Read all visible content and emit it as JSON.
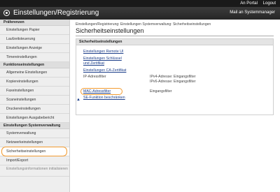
{
  "topbar": {
    "portal": "An Portal",
    "logout": "Logout"
  },
  "header": {
    "title": "Einstellungen/Registrierung",
    "mail_link": "Mail an Systemmanager"
  },
  "sidebar": {
    "sections": [
      {
        "heading": "Präferenzen",
        "items": [
          "Einstellungen Papier",
          "Laufzeitsteuerung",
          "Einstellungen Anzeige",
          "Timereinstellungen"
        ]
      },
      {
        "heading": "Funktionseinstellungen",
        "items": [
          "Allgemeine Einstellungen",
          "Kopiereinstellungen",
          "Faxeinstellungen",
          "Scaneinstellungen",
          "Druckereinstellungen",
          "Einstellungen Ausgabebericht"
        ]
      },
      {
        "heading": "Einstellungen Systemverwaltung",
        "items": [
          "Systemverwaltung",
          "Netzwerkeinstellungen",
          "Sicherheitseinstellungen",
          "Import/Export",
          "Einstellungsinformationen initialisieren"
        ]
      }
    ]
  },
  "main": {
    "breadcrumb": "Einstellungen/Registrierung: Einstellungen Systemverwaltung: Sicherheitseinstellungen",
    "title": "Sicherheitseinstellungen",
    "panel_heading": "Sicherheitseinstellungen",
    "rows": [
      {
        "label": "Einstellungen Remote UI",
        "info": ""
      },
      {
        "label": "Einstellungen Schlüssel und Zertifikat",
        "info": ""
      },
      {
        "label": "Einstellungen CA-Zertifikat",
        "info": ""
      },
      {
        "label": "IP-Adressfilter",
        "info": "IPv4-Adresse: Eingangsfilter",
        "info2": "IPv6-Adresse: Eingangsfilter"
      },
      {
        "label": "MAC-Adressfilter",
        "info": "Eingangsfilter"
      },
      {
        "label": "SE-Funktion beschränken",
        "info": ""
      }
    ],
    "to_top_symbol": "▲"
  }
}
